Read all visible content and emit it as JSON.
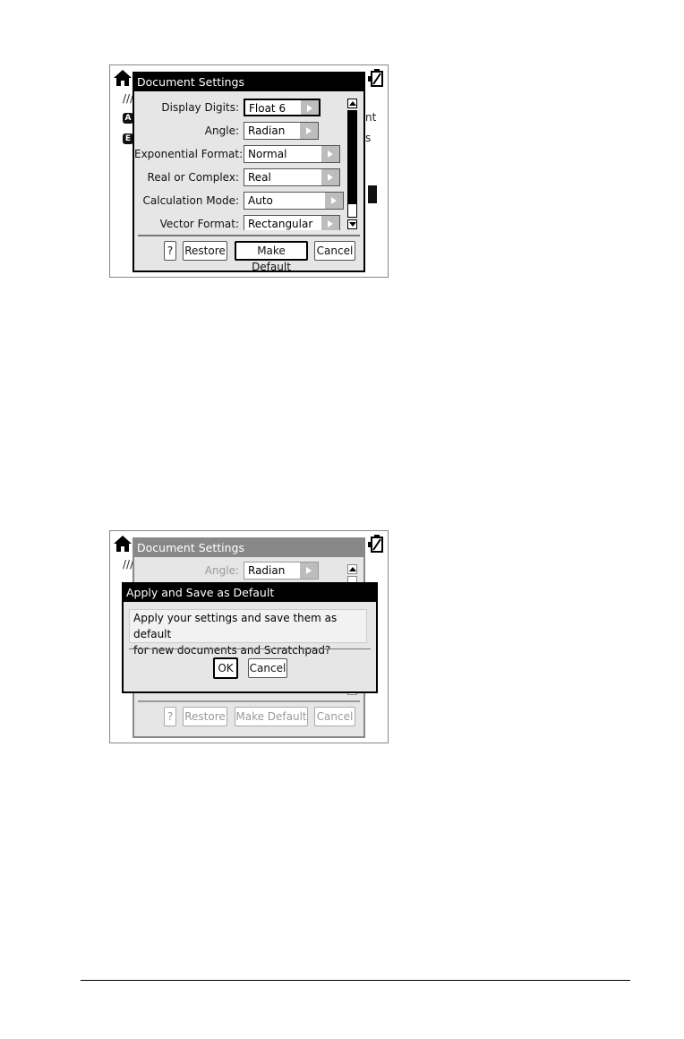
{
  "screen1": {
    "dialog_title": "Document Settings",
    "background_fragments": [
      "A",
      "E",
      "nt",
      "s"
    ],
    "settings": [
      {
        "label": "Display Digits:",
        "value": "Float 6"
      },
      {
        "label": "Angle:",
        "value": "Radian"
      },
      {
        "label": "Exponential Format:",
        "value": "Normal"
      },
      {
        "label": "Real or Complex:",
        "value": "Real"
      },
      {
        "label": "Calculation Mode:",
        "value": "Auto"
      },
      {
        "label": "Vector Format:",
        "value": "Rectangular"
      }
    ],
    "buttons": {
      "help": "?",
      "restore": "Restore",
      "make_default": "Make Default",
      "cancel": "Cancel"
    }
  },
  "screen2": {
    "dialog_title": "Document Settings",
    "visible_setting": {
      "label": "Angle:",
      "value": "Radian"
    },
    "buttons": {
      "help": "?",
      "restore": "Restore",
      "make_default": "Make Default",
      "cancel": "Cancel"
    },
    "confirm": {
      "title": "Apply and Save as Default",
      "message_line1": "Apply your settings and save them as default",
      "message_line2": "for new documents and Scratchpad?",
      "ok": "OK",
      "cancel": "Cancel"
    }
  },
  "icons": [
    "home-icon",
    "battery-icon",
    "scroll-up-icon",
    "scroll-down-icon",
    "right-arrow-icon"
  ]
}
